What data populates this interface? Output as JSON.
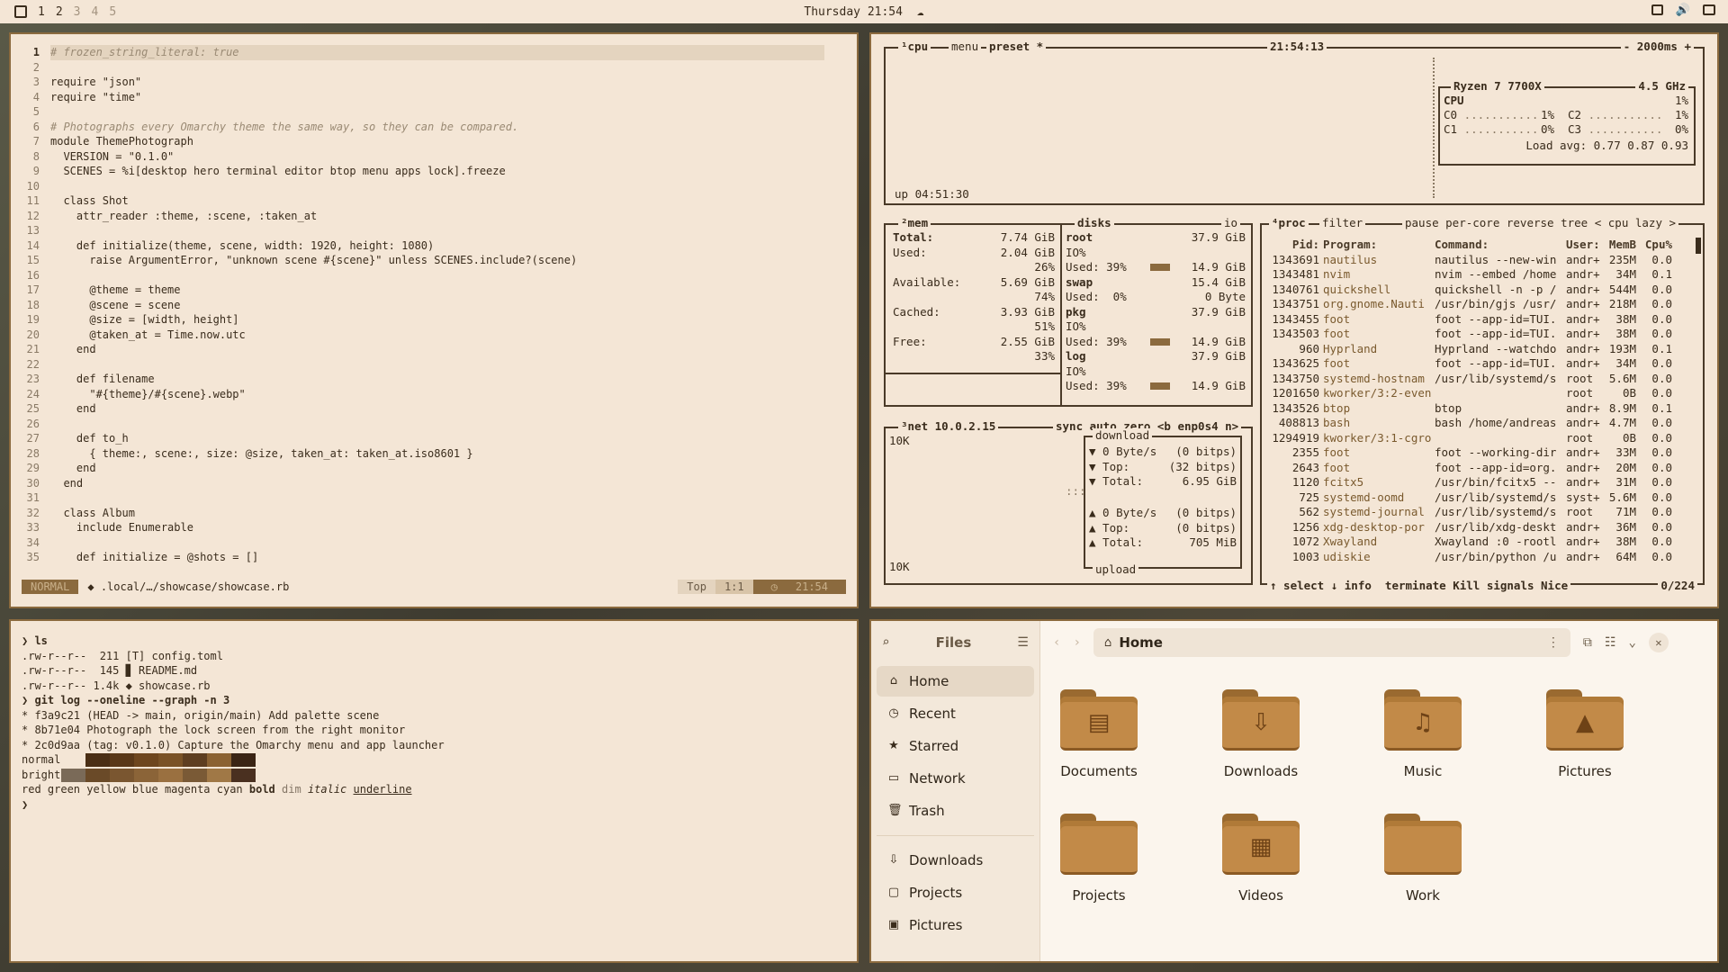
{
  "topbar": {
    "workspaces": [
      "1",
      "2",
      "3",
      "4",
      "5"
    ],
    "clock": "Thursday 21:54"
  },
  "editor": {
    "lines": [
      {
        "n": "1",
        "text": "# frozen_string_literal: true",
        "type": "comment"
      },
      {
        "n": "2",
        "text": "",
        "type": "code"
      },
      {
        "n": "3",
        "text": "require \"json\"",
        "type": "code"
      },
      {
        "n": "4",
        "text": "require \"time\"",
        "type": "code"
      },
      {
        "n": "5",
        "text": "",
        "type": "code"
      },
      {
        "n": "6",
        "text": "# Photographs every Omarchy theme the same way, so they can be compared.",
        "type": "comment"
      },
      {
        "n": "7",
        "text": "module ThemePhotograph",
        "type": "code"
      },
      {
        "n": "8",
        "text": "  VERSION = \"0.1.0\"",
        "type": "code"
      },
      {
        "n": "9",
        "text": "  SCENES = %i[desktop hero terminal editor btop menu apps lock].freeze",
        "type": "code"
      },
      {
        "n": "10",
        "text": "",
        "type": "code"
      },
      {
        "n": "11",
        "text": "  class Shot",
        "type": "code"
      },
      {
        "n": "12",
        "text": "    attr_reader :theme, :scene, :taken_at",
        "type": "code"
      },
      {
        "n": "13",
        "text": "",
        "type": "code"
      },
      {
        "n": "14",
        "text": "    def initialize(theme, scene, width: 1920, height: 1080)",
        "type": "code"
      },
      {
        "n": "15",
        "text": "      raise ArgumentError, \"unknown scene #{scene}\" unless SCENES.include?(scene)",
        "type": "code"
      },
      {
        "n": "16",
        "text": "",
        "type": "code"
      },
      {
        "n": "17",
        "text": "      @theme = theme",
        "type": "code"
      },
      {
        "n": "18",
        "text": "      @scene = scene",
        "type": "code"
      },
      {
        "n": "19",
        "text": "      @size = [width, height]",
        "type": "code"
      },
      {
        "n": "20",
        "text": "      @taken_at = Time.now.utc",
        "type": "code"
      },
      {
        "n": "21",
        "text": "    end",
        "type": "code"
      },
      {
        "n": "22",
        "text": "",
        "type": "code"
      },
      {
        "n": "23",
        "text": "    def filename",
        "type": "code"
      },
      {
        "n": "24",
        "text": "      \"#{theme}/#{scene}.webp\"",
        "type": "code"
      },
      {
        "n": "25",
        "text": "    end",
        "type": "code"
      },
      {
        "n": "26",
        "text": "",
        "type": "code"
      },
      {
        "n": "27",
        "text": "    def to_h",
        "type": "code"
      },
      {
        "n": "28",
        "text": "      { theme:, scene:, size: @size, taken_at: taken_at.iso8601 }",
        "type": "code"
      },
      {
        "n": "29",
        "text": "    end",
        "type": "code"
      },
      {
        "n": "30",
        "text": "  end",
        "type": "code"
      },
      {
        "n": "31",
        "text": "",
        "type": "code"
      },
      {
        "n": "32",
        "text": "  class Album",
        "type": "code"
      },
      {
        "n": "33",
        "text": "    include Enumerable",
        "type": "code"
      },
      {
        "n": "34",
        "text": "",
        "type": "code"
      },
      {
        "n": "35",
        "text": "    def initialize = @shots = []",
        "type": "code"
      }
    ],
    "status": {
      "mode": "NORMAL",
      "file": ".local/…/showcase/showcase.rb",
      "position_label": "Top",
      "cursor": "1:1",
      "time": "21:54"
    }
  },
  "btop": {
    "cpu_box": {
      "title": "¹cpu",
      "menu": "menu",
      "preset": "preset *",
      "time": "21:54:13",
      "interval": "- 2000ms +",
      "uptime": "up 04:51:30",
      "model": "Ryzen 7 7700X",
      "freq": "4.5 GHz",
      "cpu_label": "CPU",
      "cpu_pct": "1%",
      "cores": [
        {
          "label": "C0",
          "pct": "1%"
        },
        {
          "label": "C2",
          "pct": "1%"
        },
        {
          "label": "C1",
          "pct": "0%"
        },
        {
          "label": "C3",
          "pct": "0%"
        }
      ],
      "load_avg": "Load avg: 0.77 0.87 0.93"
    },
    "mem_box": {
      "title": "²mem",
      "rows": [
        {
          "label": "Total:",
          "value": "7.74 GiB"
        },
        {
          "label": "Used:",
          "value": "2.04 GiB",
          "pct": "26%"
        },
        {
          "label": "Available:",
          "value": "5.69 GiB",
          "pct": "74%"
        },
        {
          "label": "Cached:",
          "value": "3.93 GiB",
          "pct": "51%"
        },
        {
          "label": "Free:",
          "value": "2.55 GiB",
          "pct": "33%"
        }
      ]
    },
    "disks_box": {
      "title": "disks",
      "io": "io",
      "disks": [
        {
          "name": "root",
          "size": "37.9 GiB",
          "io": "IO%",
          "used": "Used: 39%",
          "used_size": "14.9 GiB"
        },
        {
          "name": "swap",
          "size": "15.4 GiB",
          "io": "",
          "used": "Used:  0%",
          "used_size": "0 Byte"
        },
        {
          "name": "pkg",
          "size": "37.9 GiB",
          "io": "IO%",
          "used": "Used: 39%",
          "used_size": "14.9 GiB"
        },
        {
          "name": "log",
          "size": "37.9 GiB",
          "io": "IO%",
          "used": "Used: 39%",
          "used_size": "14.9 GiB"
        }
      ]
    },
    "net_box": {
      "title": "³net",
      "ip": "10.0.2.15",
      "options": "sync auto zero <b enp0s4 n>",
      "scale_top": "10K",
      "scale_bottom": "10K",
      "download_label": "download",
      "upload_label": "upload",
      "download": [
        {
          "label": "▼ 0 Byte/s",
          "value": "(0 bitps)"
        },
        {
          "label": "▼ Top:",
          "value": "(32 bitps)"
        },
        {
          "label": "▼ Total:",
          "value": "6.95 GiB"
        }
      ],
      "upload": [
        {
          "label": "▲ 0 Byte/s",
          "value": "(0 bitps)"
        },
        {
          "label": "▲ Top:",
          "value": "(0 bitps)"
        },
        {
          "label": "▲ Total:",
          "value": "705 MiB"
        }
      ]
    },
    "proc_box": {
      "title": "⁴proc",
      "filter": "filter",
      "options": "pause per-core reverse tree < cpu lazy >",
      "headers": [
        "Pid:",
        "Program:",
        "Command:",
        "User:",
        "MemB",
        "Cpu%"
      ],
      "rows": [
        [
          "1343691",
          "nautilus",
          "nautilus --new-win",
          "andr+",
          "235M",
          "0.0"
        ],
        [
          "1343481",
          "nvim",
          "nvim --embed /home",
          "andr+",
          "34M",
          "0.1"
        ],
        [
          "1340761",
          "quickshell",
          "quickshell -n -p /",
          "andr+",
          "544M",
          "0.0"
        ],
        [
          "1343751",
          "org.gnome.Nauti",
          "/usr/bin/gjs /usr/",
          "andr+",
          "218M",
          "0.0"
        ],
        [
          "1343455",
          "foot",
          "foot --app-id=TUI.",
          "andr+",
          "38M",
          "0.0"
        ],
        [
          "1343503",
          "foot",
          "foot --app-id=TUI.",
          "andr+",
          "38M",
          "0.0"
        ],
        [
          "960",
          "Hyprland",
          "Hyprland --watchdo",
          "andr+",
          "193M",
          "0.1"
        ],
        [
          "1343625",
          "foot",
          "foot --app-id=TUI.",
          "andr+",
          "34M",
          "0.0"
        ],
        [
          "1343750",
          "systemd-hostnam",
          "/usr/lib/systemd/s",
          "root",
          "5.6M",
          "0.0"
        ],
        [
          "1201650",
          "kworker/3:2-even",
          "",
          "root",
          "0B",
          "0.0"
        ],
        [
          "1343526",
          "btop",
          "btop",
          "andr+",
          "8.9M",
          "0.1"
        ],
        [
          "408813",
          "bash",
          "bash /home/andreas",
          "andr+",
          "4.7M",
          "0.0"
        ],
        [
          "1294919",
          "kworker/3:1-cgro",
          "",
          "root",
          "0B",
          "0.0"
        ],
        [
          "2355",
          "foot",
          "foot --working-dir",
          "andr+",
          "33M",
          "0.0"
        ],
        [
          "2643",
          "foot",
          "foot --app-id=org.",
          "andr+",
          "20M",
          "0.0"
        ],
        [
          "1120",
          "fcitx5",
          "/usr/bin/fcitx5 --",
          "andr+",
          "31M",
          "0.0"
        ],
        [
          "725",
          "systemd-oomd",
          "/usr/lib/systemd/s",
          "syst+",
          "5.6M",
          "0.0"
        ],
        [
          "562",
          "systemd-journal",
          "/usr/lib/systemd/s",
          "root",
          "71M",
          "0.0"
        ],
        [
          "1256",
          "xdg-desktop-por",
          "/usr/lib/xdg-deskt",
          "andr+",
          "36M",
          "0.0"
        ],
        [
          "1072",
          "Xwayland",
          "Xwayland :0 -rootl",
          "andr+",
          "38M",
          "0.0"
        ],
        [
          "1003",
          "udiskie",
          "/usr/bin/python /u",
          "andr+",
          "64M",
          "0.0"
        ]
      ],
      "footer": "↑ select ↓ info  terminate Kill signals Nice",
      "count": "0/224"
    }
  },
  "terminal": {
    "lines": [
      {
        "text": "❯ ls",
        "bold": true
      },
      {
        "text": ".rw-r--r--  211 [T] config.toml",
        "bold": false
      },
      {
        "text": ".rw-r--r--  145 ▊ README.md",
        "bold": false
      },
      {
        "text": ".rw-r--r-- 1.4k ◆ showcase.rb",
        "bold": false
      },
      {
        "text": "❯ git log --oneline --graph -n 3",
        "bold": true
      },
      {
        "text": "* f3a9c21 (HEAD -> main, origin/main) Add palette scene",
        "bold": false
      },
      {
        "text": "* 8b71e04 Photograph the lock screen from the right monitor",
        "bold": false
      },
      {
        "text": "* 2c0d9aa (tag: v0.1.0) Capture the Omarchy menu and app launcher",
        "bold": false
      }
    ],
    "normal_label": "normal",
    "bright_label": "bright",
    "normal_colors": [
      "#f4e6d6",
      "#4a2e14",
      "#5a3818",
      "#6e461e",
      "#7a5226",
      "#5e3e20",
      "#8b6232",
      "#3a2414"
    ],
    "bright_colors": [
      "#7a6a58",
      "#6a4a28",
      "#7a5630",
      "#8b6438",
      "#9a7040",
      "#7a5a36",
      "#a07846",
      "#4a3020"
    ],
    "styles_line": {
      "plain": "red green yellow blue magenta cyan",
      "bold": "bold",
      "dim": "dim",
      "italic": "italic",
      "underline": "underline"
    },
    "prompt": "❯"
  },
  "files": {
    "title": "Files",
    "path": "Home",
    "sidebar": [
      {
        "label": "Home",
        "icon": "⌂",
        "selected": true
      },
      {
        "label": "Recent",
        "icon": "◷",
        "selected": false
      },
      {
        "label": "Starred",
        "icon": "★",
        "selected": false
      },
      {
        "label": "Network",
        "icon": "▭",
        "selected": false
      },
      {
        "label": "Trash",
        "icon": "🗑",
        "selected": false
      }
    ],
    "bookmarks": [
      {
        "label": "Downloads",
        "icon": "⇩"
      },
      {
        "label": "Projects",
        "icon": "▢"
      },
      {
        "label": "Pictures",
        "icon": "▣"
      }
    ],
    "folders": [
      {
        "label": "Documents",
        "glyph": "▤"
      },
      {
        "label": "Downloads",
        "glyph": "⇩"
      },
      {
        "label": "Music",
        "glyph": "♫"
      },
      {
        "label": "Pictures",
        "glyph": "▲"
      },
      {
        "label": "Projects",
        "glyph": ""
      },
      {
        "label": "Videos",
        "glyph": "▦"
      },
      {
        "label": "Work",
        "glyph": ""
      }
    ]
  }
}
